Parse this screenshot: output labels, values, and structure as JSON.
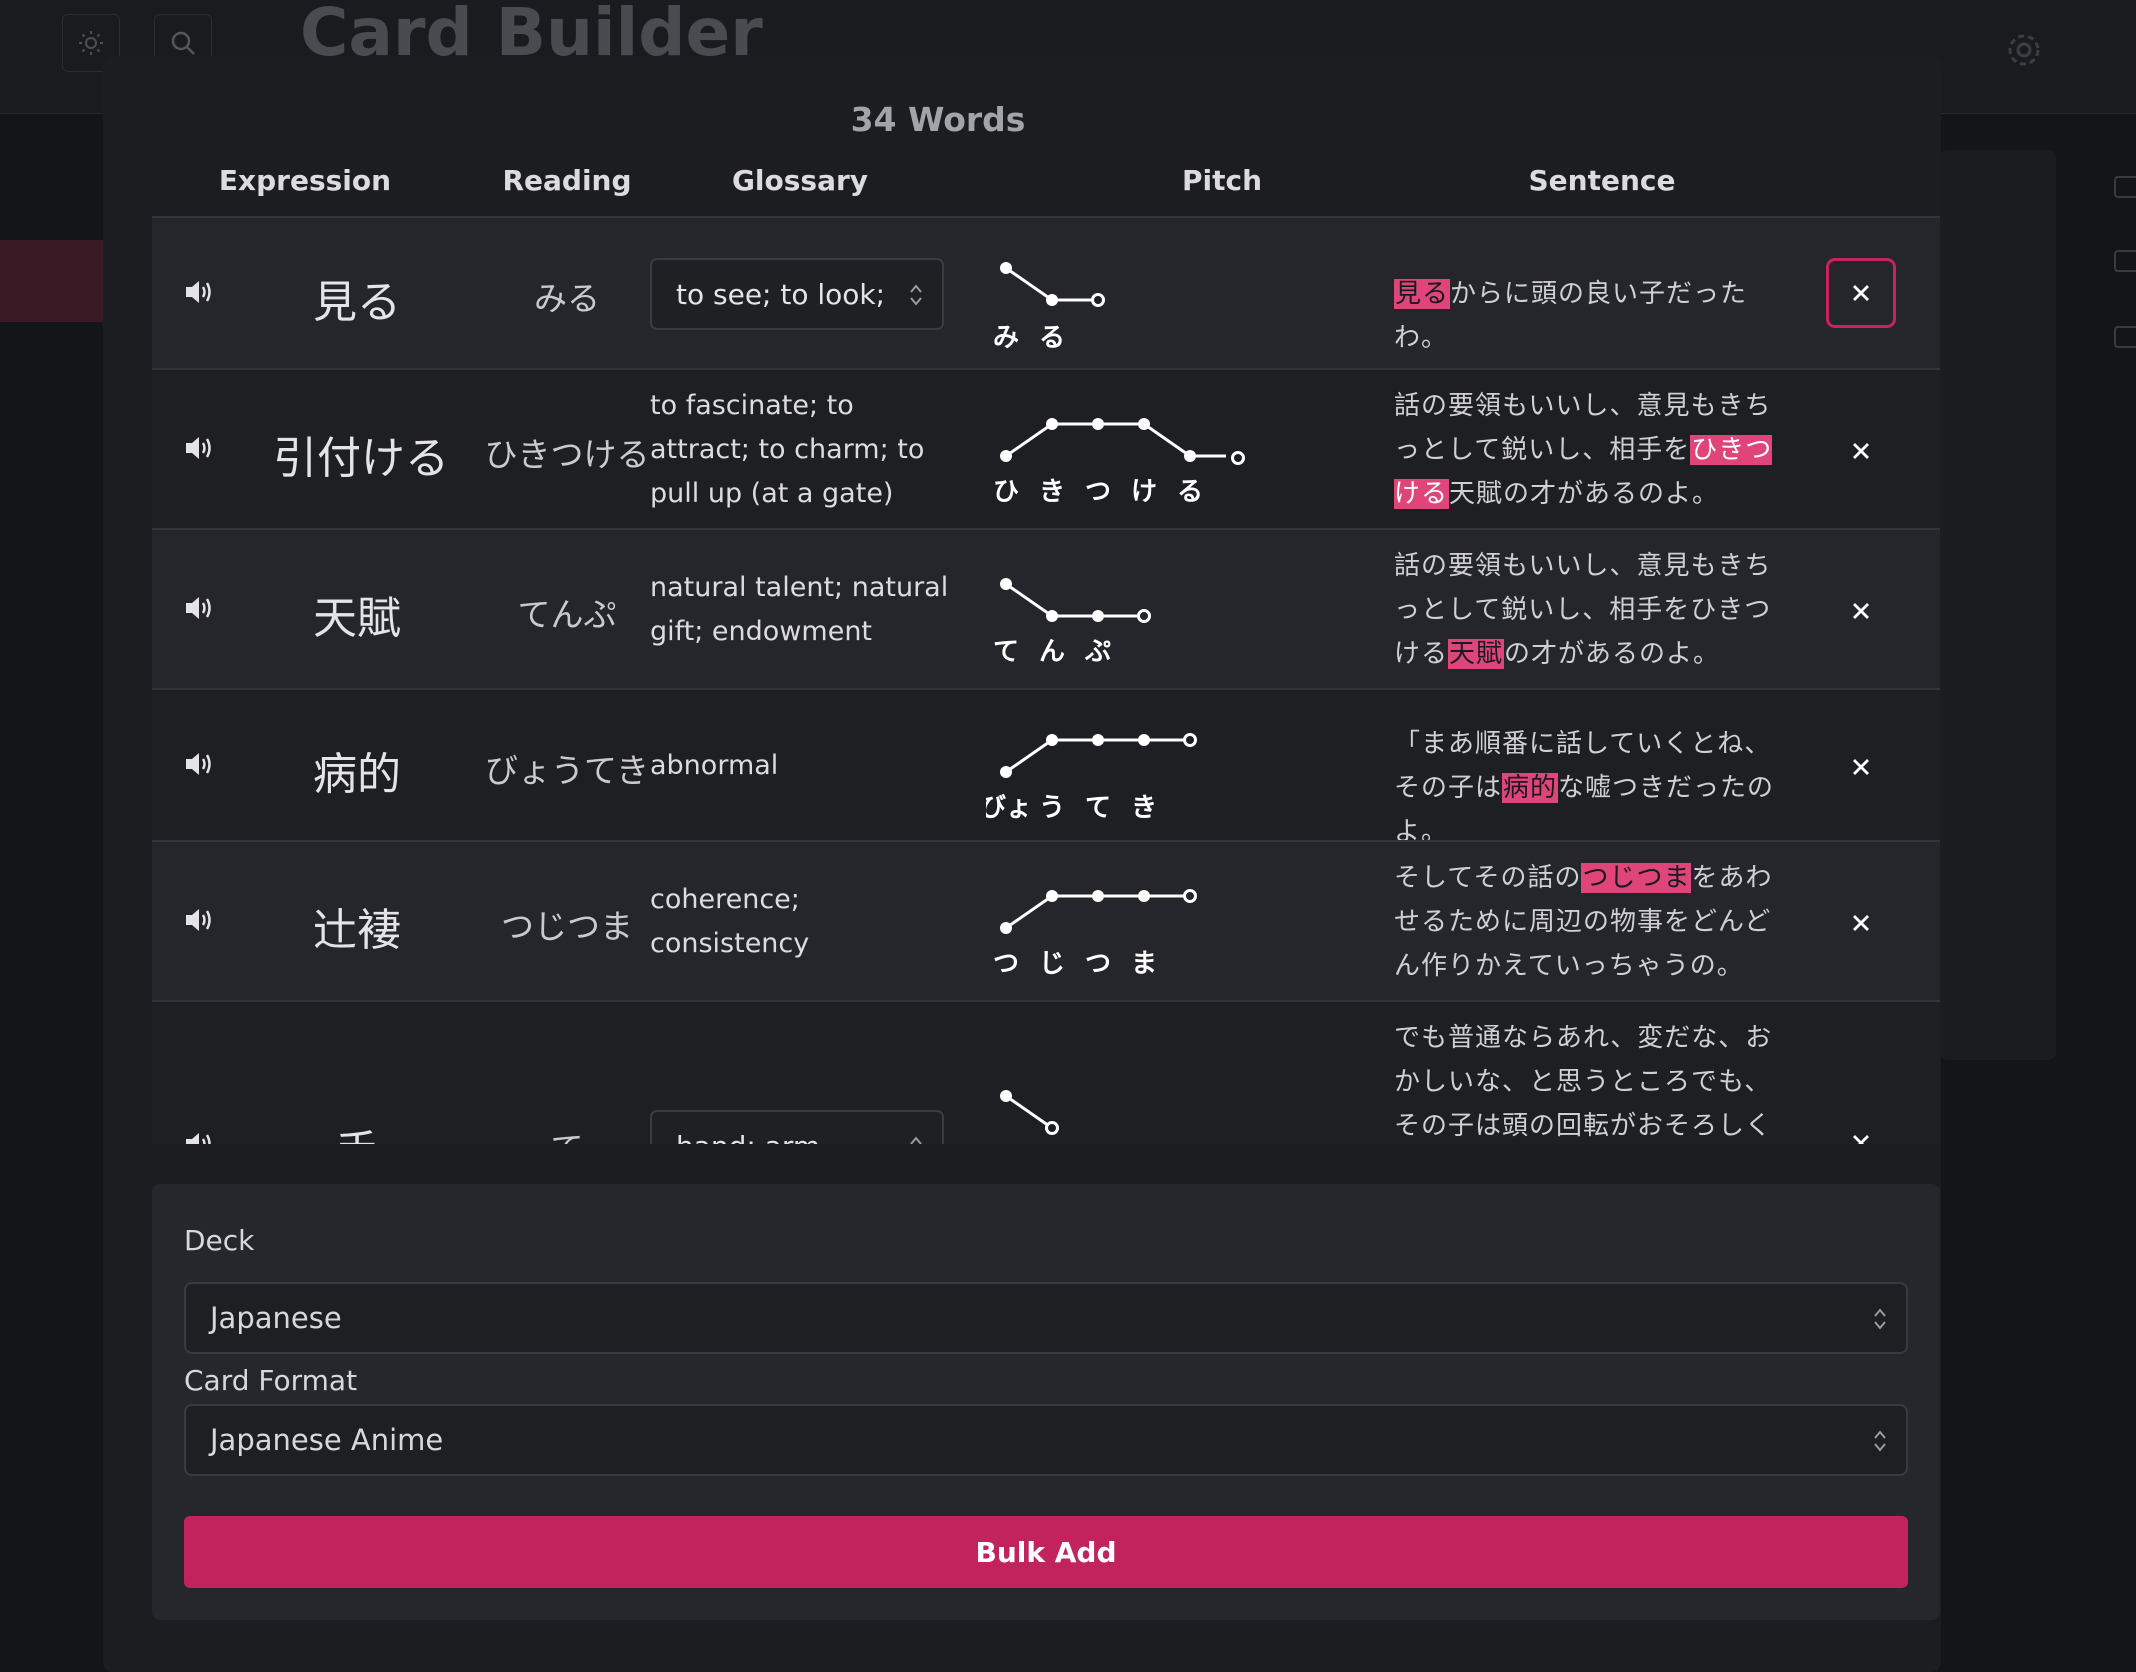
{
  "app": {
    "title": "Card Builder"
  },
  "modal": {
    "title": "34 Words",
    "columns": [
      "Expression",
      "Reading",
      "Glossary",
      "Pitch",
      "Sentence"
    ],
    "rows": [
      {
        "expression": "見る",
        "reading": "みる",
        "glossary": "to see; to look;",
        "glossary_is_select": true,
        "pitch_kana": [
          "み",
          "る"
        ],
        "sentence": {
          "before": "",
          "highlight": "見る",
          "after": "からに頭の良い子だったわ。"
        }
      },
      {
        "expression": "引付ける",
        "reading": "ひきつける",
        "glossary": "to fascinate; to attract; to charm; to pull up (at a gate)",
        "glossary_is_select": false,
        "pitch_kana": [
          "ひ",
          "き",
          "つ",
          "け",
          "る"
        ],
        "sentence": {
          "before": "話の要領もいいし、意見もきちっとして鋭いし、相手を",
          "highlight": "ひきつける",
          "after": "天賦の才があるのよ。"
        }
      },
      {
        "expression": "天賦",
        "reading": "てんぷ",
        "glossary": "natural talent; natural gift; endowment",
        "glossary_is_select": false,
        "pitch_kana": [
          "て",
          "ん",
          "ぷ"
        ],
        "sentence": {
          "before": "話の要領もいいし、意見もきちっとして鋭いし、相手をひきつける",
          "highlight": "天賦",
          "after": "の才があるのよ。"
        }
      },
      {
        "expression": "病的",
        "reading": "びょうてき",
        "glossary": "abnormal",
        "glossary_is_select": false,
        "pitch_kana": [
          "びょ",
          "う",
          "て",
          "き"
        ],
        "sentence": {
          "before": "「まあ順番に話していくとね、その子は",
          "highlight": "病的",
          "after": "な嘘つきだったのよ。"
        }
      },
      {
        "expression": "辻褄",
        "reading": "つじつま",
        "glossary": "coherence; consistency",
        "glossary_is_select": false,
        "pitch_kana": [
          "つ",
          "じ",
          "つ",
          "ま"
        ],
        "sentence": {
          "before": "そしてその話の",
          "highlight": "つじつま",
          "after": "をあわせるために周辺の物事をどんどん作りかえていっちゃうの。"
        }
      },
      {
        "expression": "手",
        "reading": "て",
        "glossary": "hand; arm",
        "glossary_is_select": true,
        "pitch_kana": [],
        "sentence": {
          "before": "でも普通ならあれ、変だな、おかしいな、と思うところでも、その子は頭の回転がおそろしく速いか",
          "highlight": "",
          "after": ""
        }
      }
    ]
  },
  "form": {
    "deck_label": "Deck",
    "deck_value": "Japanese",
    "format_label": "Card Format",
    "format_value": "Japanese Anime",
    "submit_label": "Bulk Add"
  },
  "colors": {
    "accent": "#c3235d",
    "highlight": "#e0457a",
    "background": "#1c1d21"
  },
  "icons": [
    "sun-icon",
    "search-icon",
    "gear-icon",
    "speaker-icon",
    "close-icon",
    "select-arrows-icon"
  ]
}
